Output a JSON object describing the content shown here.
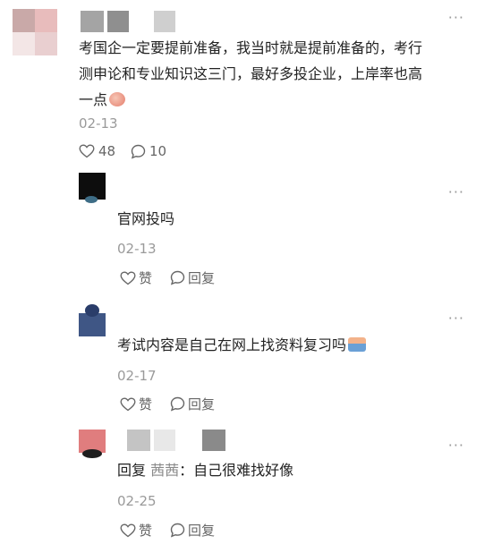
{
  "main_comment": {
    "text_lines": [
      "考国企一定要提前准备，我当时就是提前准备的，考行",
      "测申论和专业知识这三门，最好多投企业，上岸率也高",
      "一点"
    ],
    "emoji": "cheeky-face-emoji",
    "date": "02-13",
    "likes": "48",
    "comments": "10",
    "more": "···"
  },
  "replies": [
    {
      "text": "官网投吗",
      "date": "02-13",
      "like_label": "赞",
      "reply_label": "回复",
      "more": "···"
    },
    {
      "text": "考试内容是自己在网上找资料复习吗",
      "emoji": "studying-emoji",
      "date": "02-17",
      "like_label": "赞",
      "reply_label": "回复",
      "more": "···"
    },
    {
      "prefix": "回复",
      "mention": "茜茜",
      "text": "：自己很难找好像",
      "date": "02-25",
      "like_label": "赞",
      "reply_label": "回复",
      "more": "···"
    }
  ],
  "colors": {
    "date": "#9a9a9a",
    "mention": "#8a8a8a",
    "text": "#222222"
  }
}
